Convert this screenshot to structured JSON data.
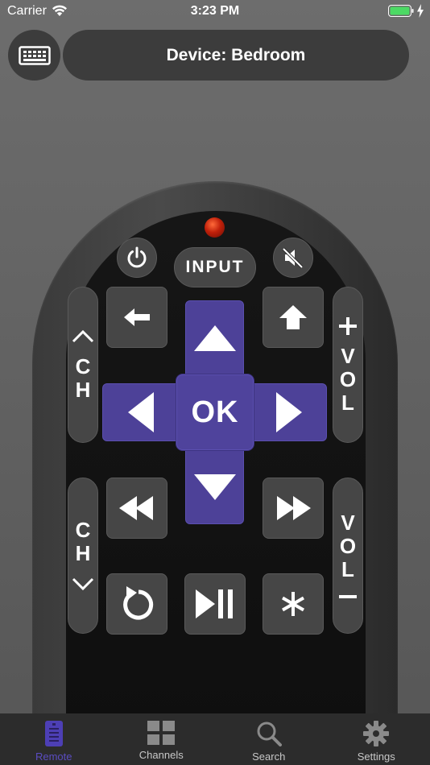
{
  "status_bar": {
    "carrier": "Carrier",
    "time": "3:23 PM"
  },
  "header": {
    "device_label": "Device: Bedroom",
    "keyboard_icon": "keyboard-icon"
  },
  "remote": {
    "input_label": "INPUT",
    "ok_label": "OK",
    "channel_left": {
      "letters": [
        "C",
        "H"
      ]
    },
    "volume_right_top": {
      "letters": [
        "V",
        "O",
        "L"
      ]
    },
    "channel_left_bottom": {
      "letters": [
        "C",
        "H"
      ]
    },
    "volume_right_bottom": {
      "letters": [
        "V",
        "O",
        "L"
      ]
    },
    "icons": [
      "power-icon",
      "mute-icon",
      "back-arrow-icon",
      "home-icon",
      "up-arrow-icon",
      "left-arrow-icon",
      "right-arrow-icon",
      "down-arrow-icon",
      "rewind-icon",
      "fast-forward-icon",
      "replay-icon",
      "play-pause-icon",
      "asterisk-icon"
    ],
    "accent_color": "#4d4198",
    "led_color": "#c0200a"
  },
  "tabs": [
    {
      "label": "Remote",
      "icon": "remote-icon",
      "active": true
    },
    {
      "label": "Channels",
      "icon": "grid-icon",
      "active": false
    },
    {
      "label": "Search",
      "icon": "search-icon",
      "active": false
    },
    {
      "label": "Settings",
      "icon": "gear-icon",
      "active": false
    }
  ]
}
